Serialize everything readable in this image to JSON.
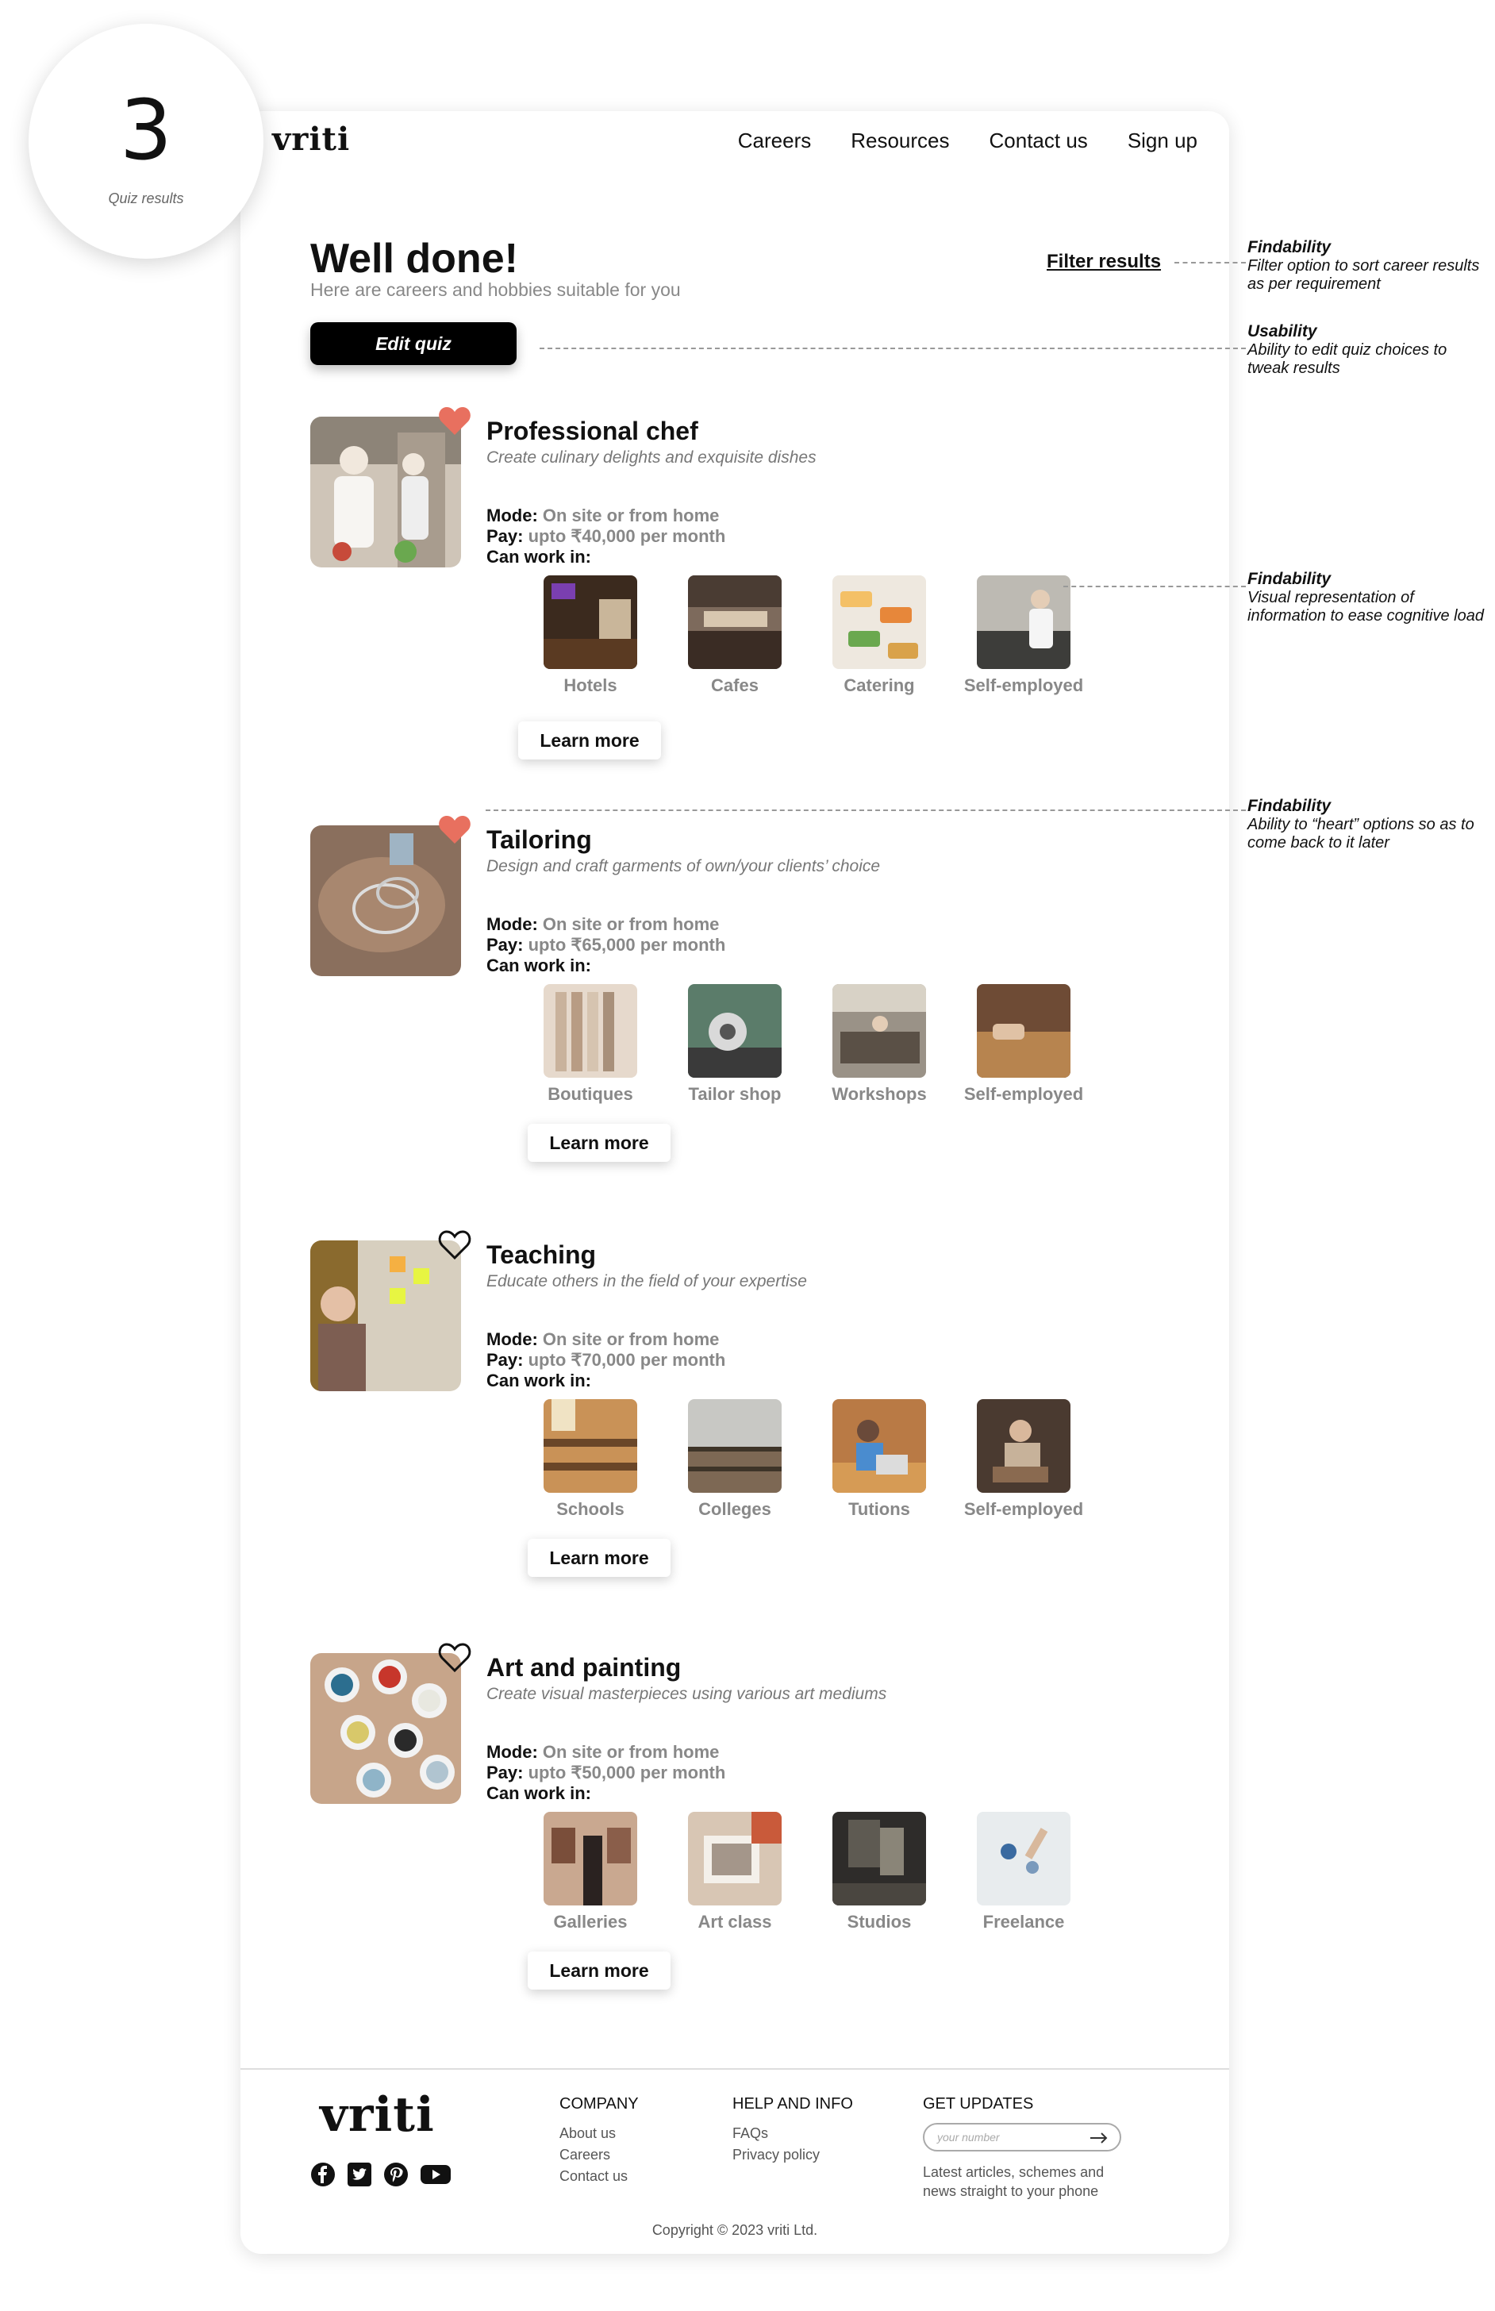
{
  "step": {
    "number": "3",
    "label": "Quiz results"
  },
  "header": {
    "logo": "vriti",
    "nav": [
      "Careers",
      "Resources",
      "Contact us",
      "Sign up"
    ]
  },
  "hero": {
    "title": "Well done!",
    "subtitle": "Here are careers and hobbies suitable for you",
    "filter_label": "Filter results",
    "edit_label": "Edit quiz"
  },
  "labels": {
    "mode": "Mode:",
    "pay": "Pay:",
    "work": "Can work in:",
    "learn_more": "Learn more"
  },
  "careers": [
    {
      "title": "Professional chef",
      "desc": "Create culinary delights and exquisite dishes",
      "mode": "On site or from home",
      "pay": "upto ₹40,000 per month",
      "favorited": true,
      "places": [
        "Hotels",
        "Cafes",
        "Catering",
        "Self-employed"
      ]
    },
    {
      "title": "Tailoring",
      "desc": "Design and craft garments of own/your clients’ choice",
      "mode": "On site or from home",
      "pay": "upto ₹65,000 per month",
      "favorited": true,
      "places": [
        "Boutiques",
        "Tailor shop",
        "Workshops",
        "Self-employed"
      ]
    },
    {
      "title": "Teaching",
      "desc": "Educate others in the field of your expertise",
      "mode": "On site or from home",
      "pay": "upto ₹70,000 per month",
      "favorited": false,
      "places": [
        "Schools",
        "Colleges",
        "Tutions",
        "Self-employed"
      ]
    },
    {
      "title": "Art and painting",
      "desc": "Create visual masterpieces using various art mediums",
      "mode": "On site or from home",
      "pay": "upto ₹50,000 per month",
      "favorited": false,
      "places": [
        "Galleries",
        "Art class",
        "Studios",
        "Freelance"
      ]
    }
  ],
  "footer": {
    "logo": "vriti",
    "company": {
      "head": "COMPANY",
      "links": [
        "About us",
        "Careers",
        "Contact us"
      ]
    },
    "help": {
      "head": "HELP AND INFO",
      "links": [
        "FAQs",
        "Privacy policy"
      ]
    },
    "updates": {
      "head": "GET UPDATES",
      "placeholder": "your number",
      "note": "Latest articles, schemes and news straight to your phone"
    },
    "copyright": "Copyright © 2023 vriti Ltd."
  },
  "annotations": [
    {
      "heading": "Findability",
      "text": "Filter option to sort career results as per requirement"
    },
    {
      "heading": "Usability",
      "text": "Ability to edit quiz choices to tweak results"
    },
    {
      "heading": "Findability",
      "text": "Visual representation of information to ease cognitive load"
    },
    {
      "heading": "Findability",
      "text": "Ability to “heart” options so as to come back to it later"
    }
  ],
  "colors": {
    "heart_filled": "#e8705f",
    "button_bg": "#000000",
    "muted_text": "#888888"
  }
}
